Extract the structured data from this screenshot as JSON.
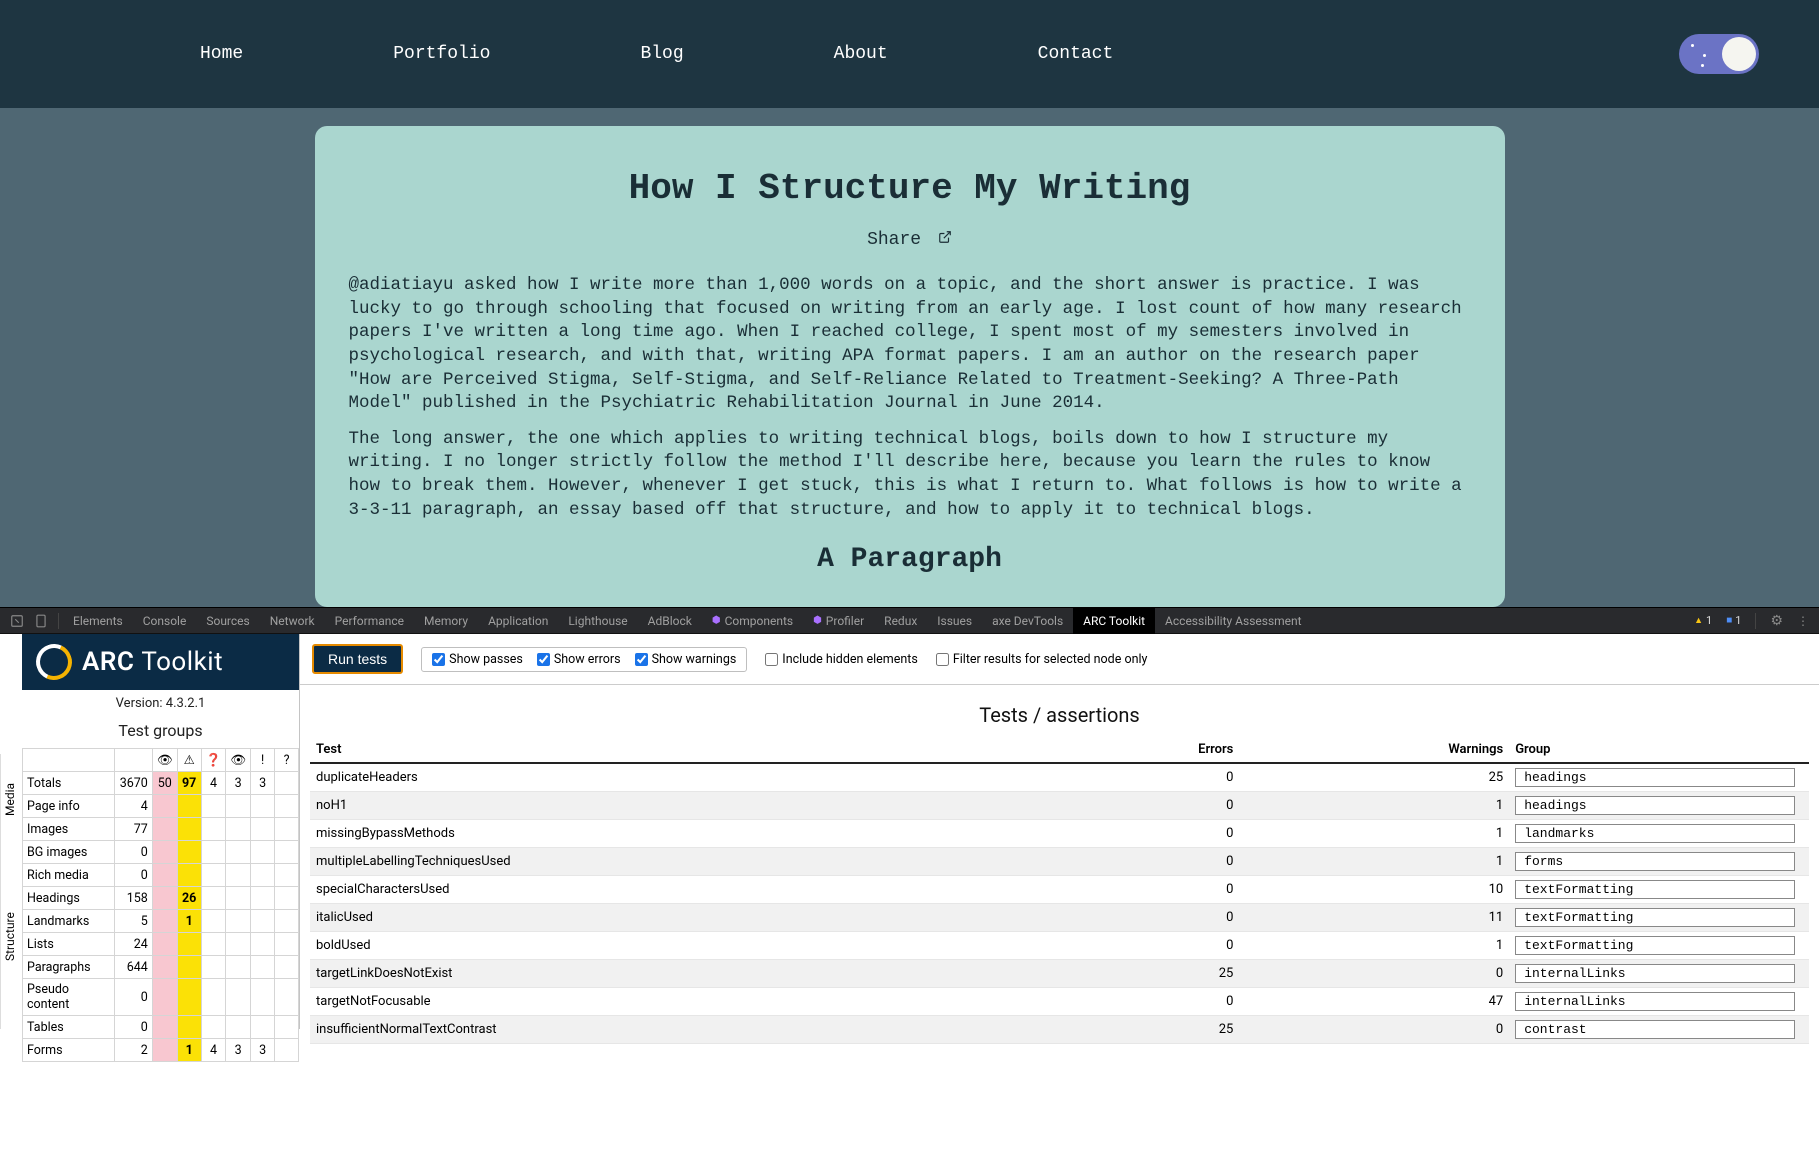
{
  "nav": {
    "items": [
      "Home",
      "Portfolio",
      "Blog",
      "About",
      "Contact"
    ]
  },
  "article": {
    "title": "How I Structure My Writing",
    "share_label": "Share",
    "p1": "@adiatiayu asked how I write more than 1,000 words on a topic, and the short answer is practice. I was lucky to go through schooling that focused on writing from an early age. I lost count of how many research papers I've written a long time ago. When I reached college, I spent most of my semesters involved in psychological research, and with that, writing APA format papers. I am an author on the research paper \"How are Perceived Stigma, Self-Stigma, and Self-Reliance Related to Treatment-Seeking? A Three-Path Model\" published in the Psychiatric Rehabilitation Journal in June 2014.",
    "p2": "The long answer, the one which applies to writing technical blogs, boils down to how I structure my writing. I no longer strictly follow the method I'll describe here, because you learn the rules to know how to break them. However, whenever I get stuck, this is what I return to. What follows is how to write a 3-3-11 paragraph, an essay based off that structure, and how to apply it to technical blogs.",
    "h2": "A Paragraph"
  },
  "devtools": {
    "tabs": [
      "Elements",
      "Console",
      "Sources",
      "Network",
      "Performance",
      "Memory",
      "Application",
      "Lighthouse",
      "AdBlock",
      "Components",
      "Profiler",
      "Redux",
      "Issues",
      "axe DevTools",
      "ARC Toolkit",
      "Accessibility Assessment"
    ],
    "active_tab": "ARC Toolkit",
    "warn_count": "1",
    "info_count": "1"
  },
  "arc": {
    "logo": "ARC",
    "logo2": "Toolkit",
    "version": "Version: 4.3.2.1",
    "test_groups_title": "Test groups",
    "header_icons": [
      "👁",
      "⚠",
      "?",
      "👁",
      "!",
      "?"
    ],
    "groups": [
      {
        "section": "",
        "label": "Totals",
        "count": "3670",
        "c2": "50",
        "c3": "97",
        "c4": "4",
        "c5": "3",
        "c6": "3"
      },
      {
        "section": "",
        "label": "Page info",
        "count": "4"
      },
      {
        "section": "Media",
        "label": "Images",
        "count": "77"
      },
      {
        "section": "",
        "label": "BG images",
        "count": "0"
      },
      {
        "section": "",
        "label": "Rich media",
        "count": "0"
      },
      {
        "section": "Structure",
        "label": "Headings",
        "count": "158",
        "c3": "26"
      },
      {
        "section": "",
        "label": "Landmarks",
        "count": "5",
        "c3": "1"
      },
      {
        "section": "",
        "label": "Lists",
        "count": "24"
      },
      {
        "section": "",
        "label": "Paragraphs",
        "count": "644"
      },
      {
        "section": "",
        "label": "Pseudo content",
        "count": "0"
      },
      {
        "section": "",
        "label": "Tables",
        "count": "0"
      },
      {
        "section": "",
        "label": "Forms",
        "count": "2",
        "c3": "1",
        "c4": "4",
        "c5": "3",
        "c6": "3"
      }
    ],
    "run_tests": "Run tests",
    "show_passes": "Show passes",
    "show_errors": "Show errors",
    "show_warnings": "Show warnings",
    "include_hidden": "Include hidden elements",
    "filter_node": "Filter results for selected node only",
    "tests_heading": "Tests / assertions",
    "table_headers": {
      "test": "Test",
      "errors": "Errors",
      "warnings": "Warnings",
      "group": "Group"
    },
    "tests": [
      {
        "test": "duplicateHeaders",
        "errors": "0",
        "warnings": "25",
        "group": "headings"
      },
      {
        "test": "noH1",
        "errors": "0",
        "warnings": "1",
        "group": "headings"
      },
      {
        "test": "missingBypassMethods",
        "errors": "0",
        "warnings": "1",
        "group": "landmarks"
      },
      {
        "test": "multipleLabellingTechniquesUsed",
        "errors": "0",
        "warnings": "1",
        "group": "forms"
      },
      {
        "test": "specialCharactersUsed",
        "errors": "0",
        "warnings": "10",
        "group": "textFormatting"
      },
      {
        "test": "italicUsed",
        "errors": "0",
        "warnings": "11",
        "group": "textFormatting"
      },
      {
        "test": "boldUsed",
        "errors": "0",
        "warnings": "1",
        "group": "textFormatting"
      },
      {
        "test": "targetLinkDoesNotExist",
        "errors": "25",
        "warnings": "0",
        "group": "internalLinks"
      },
      {
        "test": "targetNotFocusable",
        "errors": "0",
        "warnings": "47",
        "group": "internalLinks"
      },
      {
        "test": "insufficientNormalTextContrast",
        "errors": "25",
        "warnings": "0",
        "group": "contrast"
      }
    ]
  }
}
